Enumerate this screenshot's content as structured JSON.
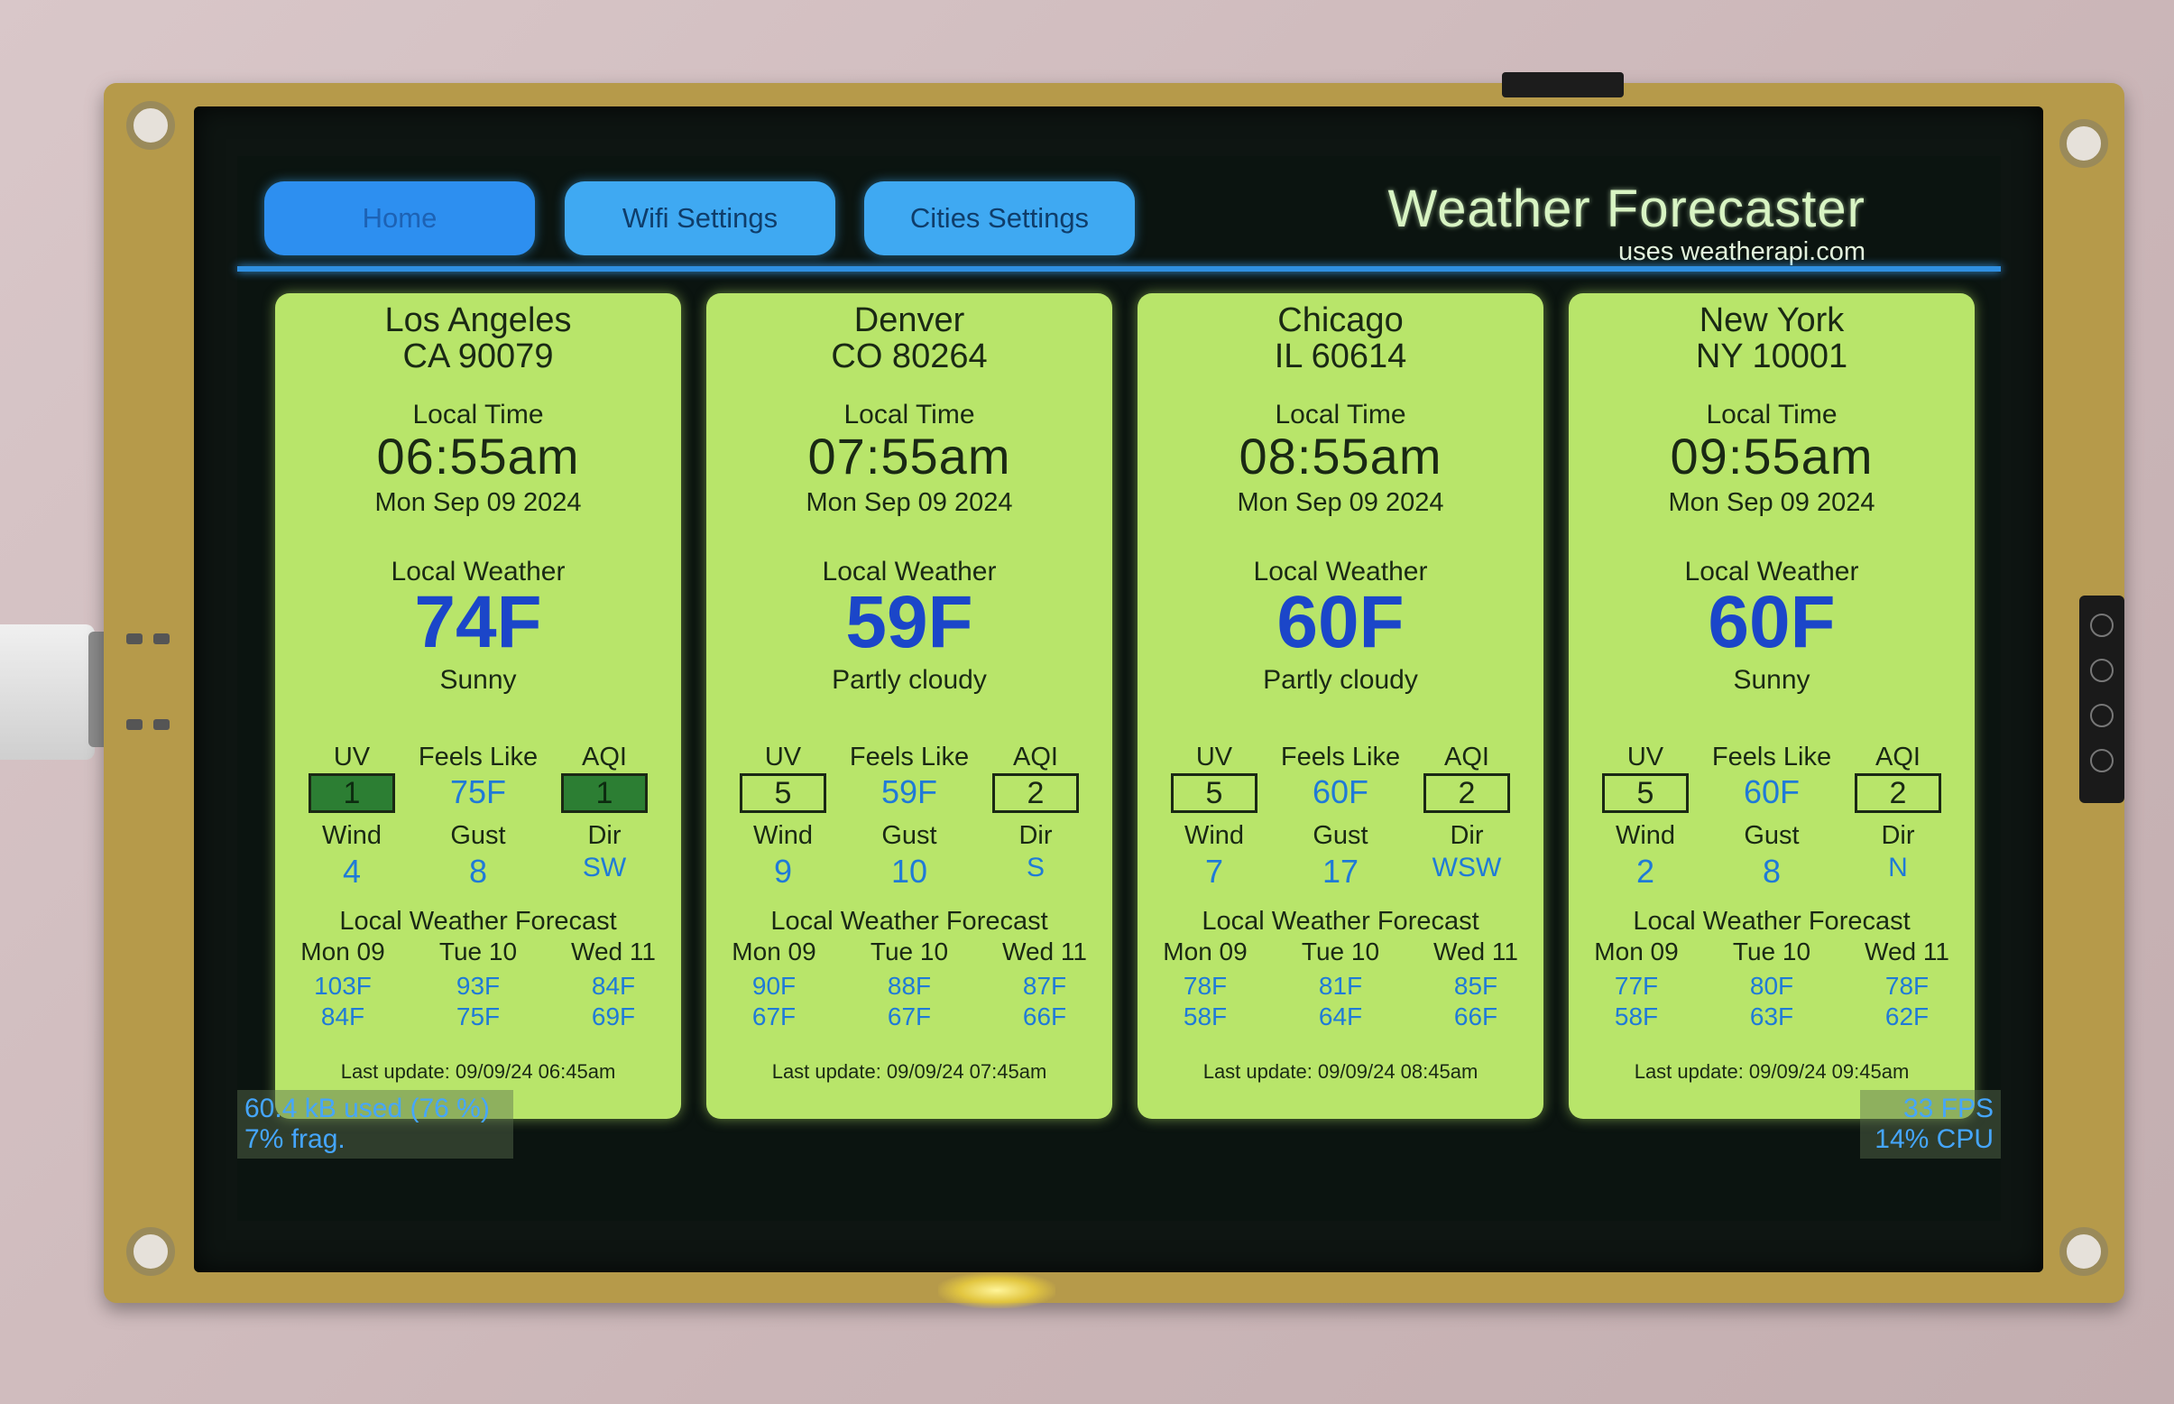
{
  "nav": {
    "buttons": [
      {
        "label": "Home"
      },
      {
        "label": "Wifi Settings"
      },
      {
        "label": "Cities Settings"
      }
    ]
  },
  "header": {
    "title": "Weather Forecaster",
    "subtitle": "uses weatherapi.com"
  },
  "labels": {
    "local_time": "Local Time",
    "local_weather": "Local Weather",
    "uv": "UV",
    "feels_like": "Feels Like",
    "aqi": "AQI",
    "wind": "Wind",
    "gust": "Gust",
    "dir": "Dir",
    "forecast": "Local Weather Forecast"
  },
  "cities": [
    {
      "city": "Los Angeles",
      "zip": "CA 90079",
      "time": "06:55am",
      "date": "Mon Sep 09 2024",
      "temp": "74F",
      "condition": "Sunny",
      "uv": "1",
      "feels_like": "75F",
      "aqi": "1",
      "wind": "4",
      "gust": "8",
      "dir": "SW",
      "forecast": [
        {
          "day": "Mon 09",
          "hi": "103F",
          "lo": "84F"
        },
        {
          "day": "Tue 10",
          "hi": "93F",
          "lo": "75F"
        },
        {
          "day": "Wed 11",
          "hi": "84F",
          "lo": "69F"
        }
      ],
      "last_update": "Last update: 09/09/24 06:45am"
    },
    {
      "city": "Denver",
      "zip": "CO 80264",
      "time": "07:55am",
      "date": "Mon Sep 09 2024",
      "temp": "59F",
      "condition": "Partly cloudy",
      "uv": "5",
      "feels_like": "59F",
      "aqi": "2",
      "wind": "9",
      "gust": "10",
      "dir": "S",
      "forecast": [
        {
          "day": "Mon 09",
          "hi": "90F",
          "lo": "67F"
        },
        {
          "day": "Tue 10",
          "hi": "88F",
          "lo": "67F"
        },
        {
          "day": "Wed 11",
          "hi": "87F",
          "lo": "66F"
        }
      ],
      "last_update": "Last update: 09/09/24 07:45am"
    },
    {
      "city": "Chicago",
      "zip": "IL 60614",
      "time": "08:55am",
      "date": "Mon Sep 09 2024",
      "temp": "60F",
      "condition": "Partly cloudy",
      "uv": "5",
      "feels_like": "60F",
      "aqi": "2",
      "wind": "7",
      "gust": "17",
      "dir": "WSW",
      "forecast": [
        {
          "day": "Mon 09",
          "hi": "78F",
          "lo": "58F"
        },
        {
          "day": "Tue 10",
          "hi": "81F",
          "lo": "64F"
        },
        {
          "day": "Wed 11",
          "hi": "85F",
          "lo": "66F"
        }
      ],
      "last_update": "Last update: 09/09/24 08:45am"
    },
    {
      "city": "New York",
      "zip": "NY 10001",
      "time": "09:55am",
      "date": "Mon Sep 09 2024",
      "temp": "60F",
      "condition": "Sunny",
      "uv": "5",
      "feels_like": "60F",
      "aqi": "2",
      "wind": "2",
      "gust": "8",
      "dir": "N",
      "forecast": [
        {
          "day": "Mon 09",
          "hi": "77F",
          "lo": "58F"
        },
        {
          "day": "Tue 10",
          "hi": "80F",
          "lo": "63F"
        },
        {
          "day": "Wed 11",
          "hi": "78F",
          "lo": "62F"
        }
      ],
      "last_update": "Last update: 09/09/24 09:45am"
    }
  ],
  "status": {
    "memory": "60.4 kB used (76 %)",
    "frag": "7% frag.",
    "fps": "33 FPS",
    "cpu": "14% CPU"
  },
  "colors": {
    "card_bg": "#b8e56a",
    "temp_blue": "#1b46c9",
    "value_blue": "#1f7ad8",
    "nav_blue": "#3fa9f2",
    "uv_aqi_low_fill": "#2c7e33"
  }
}
